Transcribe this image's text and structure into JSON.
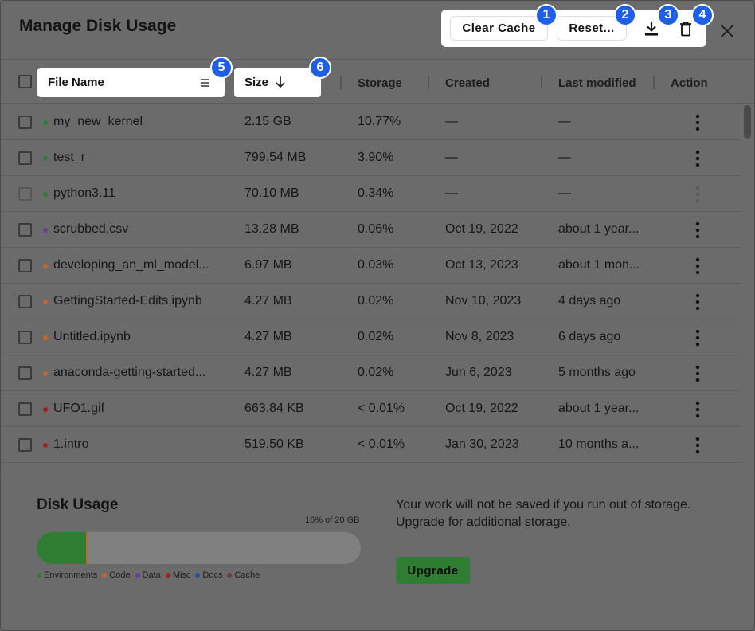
{
  "dialog": {
    "title": "Manage Disk Usage"
  },
  "toolbar": {
    "clear_cache_label": "Clear Cache",
    "reset_label": "Reset...",
    "download_icon": "download-icon",
    "trash_icon": "trash-icon",
    "close_icon": "close-icon"
  },
  "badges": [
    "1",
    "2",
    "3",
    "4",
    "5",
    "6"
  ],
  "table": {
    "columns": [
      "File Name",
      "Size",
      "Storage",
      "Created",
      "Last modified",
      "Action"
    ],
    "sort_icon": "arrow-down-icon",
    "menu_icon": "hamburger-icon",
    "rows": [
      {
        "name": "my_new_kernel",
        "size": "2.15 GB",
        "storage": "10.77%",
        "created": "—",
        "modified": "—",
        "dot": "#2e7d32",
        "enabled": true
      },
      {
        "name": "test_r",
        "size": "799.54 MB",
        "storage": "3.90%",
        "created": "—",
        "modified": "—",
        "dot": "#2e7d32",
        "enabled": true
      },
      {
        "name": "python3.11",
        "size": "70.10 MB",
        "storage": "0.34%",
        "created": "—",
        "modified": "—",
        "dot": "#2e7d32",
        "enabled": false
      },
      {
        "name": "scrubbed.csv",
        "size": "13.28 MB",
        "storage": "0.06%",
        "created": "Oct 19, 2022",
        "modified": "about 1 year...",
        "dot": "#6a3aa3",
        "enabled": true
      },
      {
        "name": "developing_an_ml_model...",
        "size": "6.97 MB",
        "storage": "0.03%",
        "created": "Oct 13, 2023",
        "modified": "about 1 mon...",
        "dot": "#c8662a",
        "enabled": true
      },
      {
        "name": "GettingStarted-Edits.ipynb",
        "size": "4.27 MB",
        "storage": "0.02%",
        "created": "Nov 10, 2023",
        "modified": "4 days ago",
        "dot": "#c8662a",
        "enabled": true
      },
      {
        "name": "Untitled.ipynb",
        "size": "4.27 MB",
        "storage": "0.02%",
        "created": "Nov 8, 2023",
        "modified": "6 days ago",
        "dot": "#c8662a",
        "enabled": true
      },
      {
        "name": "anaconda-getting-started...",
        "size": "4.27 MB",
        "storage": "0.02%",
        "created": "Jun 6, 2023",
        "modified": "5 months ago",
        "dot": "#c8662a",
        "enabled": true
      },
      {
        "name": "UFO1.gif",
        "size": "663.84 KB",
        "storage": "< 0.01%",
        "created": "Oct 19, 2022",
        "modified": "about 1 year...",
        "dot": "#a31f1f",
        "enabled": true
      },
      {
        "name": "1.intro",
        "size": "519.50 KB",
        "storage": "< 0.01%",
        "created": "Jan 30, 2023",
        "modified": "10 months a...",
        "dot": "#a31f1f",
        "enabled": true
      }
    ]
  },
  "disk_usage": {
    "title": "Disk Usage",
    "percent_label": "16% of 20 GB",
    "used_fraction": 0.16,
    "legend": [
      {
        "label": "Environments",
        "color": "#2e7d32"
      },
      {
        "label": "Code",
        "color": "#c8662a"
      },
      {
        "label": "Data",
        "color": "#6a3aa3"
      },
      {
        "label": "Misc",
        "color": "#a31f1f"
      },
      {
        "label": "Docs",
        "color": "#1f4fa3"
      },
      {
        "label": "Cache",
        "color": "#6b3a3a"
      }
    ],
    "warning": "Your work will not be saved if you run out of storage. Upgrade for additional storage.",
    "upgrade_label": "Upgrade"
  }
}
